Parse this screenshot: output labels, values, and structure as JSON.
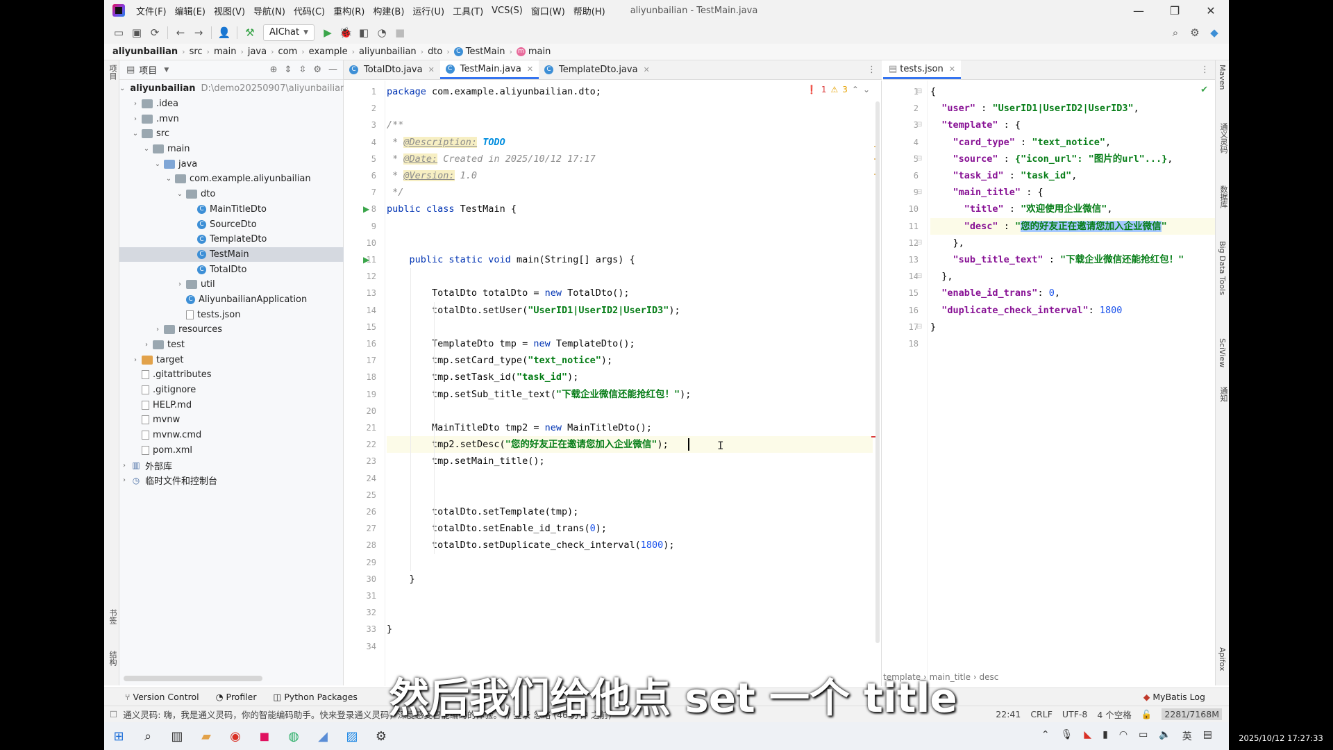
{
  "menubar": {
    "items": [
      "文件(F)",
      "编辑(E)",
      "视图(V)",
      "导航(N)",
      "代码(C)",
      "重构(R)",
      "构建(B)",
      "运行(U)",
      "工具(T)",
      "VCS(S)",
      "窗口(W)",
      "帮助(H)"
    ],
    "window_title": "aliyunbailian - TestMain.java"
  },
  "toolbar": {
    "run_config": "AIChat"
  },
  "breadcrumb": [
    "aliyunbailian",
    "src",
    "main",
    "java",
    "com",
    "example",
    "aliyunbailian",
    "dto",
    "TestMain",
    "main"
  ],
  "left_strip": {
    "project_label": "项目",
    "bookmarks_label": "书签",
    "structure_label": "结构"
  },
  "project": {
    "header": "项目",
    "root_name": "aliyunbailian",
    "root_path": "D:\\demo20250907\\aliyunbailian",
    "nodes": [
      {
        "label": ".idea"
      },
      {
        "label": ".mvn"
      },
      {
        "label": "src"
      },
      {
        "label": "main"
      },
      {
        "label": "java"
      },
      {
        "label": "com.example.aliyunbailian"
      },
      {
        "label": "dto"
      },
      {
        "label": "MainTitleDto"
      },
      {
        "label": "SourceDto"
      },
      {
        "label": "TemplateDto"
      },
      {
        "label": "TestMain"
      },
      {
        "label": "TotalDto"
      },
      {
        "label": "util"
      },
      {
        "label": "AliyunbailianApplication"
      },
      {
        "label": "tests.json"
      },
      {
        "label": "resources"
      },
      {
        "label": "test"
      },
      {
        "label": "target"
      },
      {
        "label": ".gitattributes"
      },
      {
        "label": ".gitignore"
      },
      {
        "label": "HELP.md"
      },
      {
        "label": "mvnw"
      },
      {
        "label": "mvnw.cmd"
      },
      {
        "label": "pom.xml"
      },
      {
        "label": "外部库"
      },
      {
        "label": "临时文件和控制台"
      }
    ]
  },
  "left_tabs": [
    "TotalDto.java",
    "TestMain.java",
    "TemplateDto.java"
  ],
  "right_tabs": [
    "tests.json"
  ],
  "inspections": {
    "errors": "1",
    "warnings": "3"
  },
  "left_editor": {
    "line_numbers": [
      "1",
      "2",
      "3",
      "4",
      "5",
      "6",
      "7",
      "8",
      "9",
      "10",
      "11",
      "12",
      "13",
      "14",
      "15",
      "16",
      "17",
      "18",
      "19",
      "20",
      "21",
      "22",
      "23",
      "24",
      "25",
      "26",
      "27",
      "28",
      "29",
      "30",
      "31",
      "32",
      "33",
      "34"
    ],
    "lines": [
      [
        "package com.example.aliyunbailian.dto;"
      ],
      [
        ""
      ],
      [
        "/**"
      ],
      [
        " * ",
        "@Description:",
        " ",
        "TODO"
      ],
      [
        " * ",
        "@Date:",
        " Created in 2025/10/12 17:17"
      ],
      [
        " * ",
        "@Version:",
        " 1.0"
      ],
      [
        " */"
      ],
      [
        "public class ",
        "TestMain {"
      ],
      [
        ""
      ],
      [
        ""
      ],
      [
        "    public static void ",
        "main(String[] args) {"
      ],
      [
        ""
      ],
      [
        "        TotalDto totalDto = ",
        "new ",
        "TotalDto();"
      ],
      [
        "        totalDto.setUser(",
        "\"UserID1|UserID2|UserID3\"",
        ");"
      ],
      [
        ""
      ],
      [
        "        TemplateDto tmp = ",
        "new ",
        "TemplateDto();"
      ],
      [
        "        tmp.setCard_type(",
        "\"text_notice\"",
        ");"
      ],
      [
        "        tmp.setTask_id(",
        "\"task_id\"",
        ");"
      ],
      [
        "        tmp.setSub_title_text(",
        "\"下载企业微信还能抢红包！\"",
        ");"
      ],
      [
        ""
      ],
      [
        "        MainTitleDto tmp2 = ",
        "new ",
        "MainTitleDto();"
      ],
      [
        "        tmp2.setDesc(",
        "\"您的好友正在邀请您加入企业微信\"",
        ");"
      ],
      [
        "        tmp.setMain_title();"
      ],
      [
        ""
      ],
      [
        ""
      ],
      [
        "        totalDto.setTemplate(tmp);"
      ],
      [
        "        totalDto.setEnable_id_trans(",
        "0",
        ");"
      ],
      [
        "        totalDto.setDuplicate_check_interval(",
        "1800",
        ");"
      ],
      [
        ""
      ],
      [
        "    }"
      ],
      [
        ""
      ],
      [
        ""
      ],
      [
        "}"
      ],
      [
        ""
      ]
    ]
  },
  "right_editor": {
    "line_numbers": [
      "1",
      "2",
      "3",
      "4",
      "5",
      "6",
      "9",
      "10",
      "11",
      "12",
      "13",
      "14",
      "15",
      "16",
      "17",
      "18"
    ],
    "lines": [
      [
        "{"
      ],
      [
        "  ",
        "\"user\"",
        " : ",
        "\"UserID1|UserID2|UserID3\"",
        ","
      ],
      [
        "  ",
        "\"template\"",
        " : {"
      ],
      [
        "    ",
        "\"card_type\"",
        " : ",
        "\"text_notice\"",
        ","
      ],
      [
        "    ",
        "\"source\"",
        " : ",
        "{\"icon_url\": \"图片的url\"...}",
        ","
      ],
      [
        "    ",
        "\"task_id\"",
        " : ",
        "\"task_id\"",
        ","
      ],
      [
        "    ",
        "\"main_title\"",
        " : {"
      ],
      [
        "      ",
        "\"title\"",
        " : ",
        "\"欢迎使用企业微信\"",
        ","
      ],
      [
        "      ",
        "\"desc\"",
        " : ",
        "\"",
        "您的好友正在邀请您加入企业微信",
        "\""
      ],
      [
        "    },"
      ],
      [
        "    ",
        "\"sub_title_text\"",
        " : ",
        "\"下载企业微信还能抢红包！\""
      ],
      [
        "  },"
      ],
      [
        "  ",
        "\"enable_id_trans\"",
        ": ",
        "0",
        ","
      ],
      [
        "  ",
        "\"duplicate_check_interval\"",
        ": ",
        "1800"
      ],
      [
        "}"
      ],
      [
        ""
      ]
    ],
    "bottom_breadcrumb": "template  ›  main_title  ›  desc"
  },
  "right_strip": [
    "Maven",
    "通义灵码",
    "数据库",
    "Big Data Tools",
    "SciView",
    "通知",
    "Apifox"
  ],
  "bottom_tools": {
    "version_control": "Version Control",
    "profiler": "Profiler",
    "python_packages": "Python Packages",
    "mybatis_log": "MyBatis Log"
  },
  "status": {
    "message": "通义灵码: 嗨，我是通义灵码，你的智能编码助手。快来登录通义灵码，深度感受智能编码的体验。 // 登录   忽略 (46 分钟 之前)",
    "position": "22:41",
    "line_sep": "CRLF",
    "encoding": "UTF-8",
    "indent": "4 个空格",
    "memory": "2281/7168M"
  },
  "taskbar": {
    "ime": "英",
    "clock": "2025/10/12 17:27:33"
  },
  "subtitle": "然后我们给他点 set 一个 title",
  "colors": {
    "accent": "#3574f0",
    "keyword": "#0033b3",
    "string": "#067d17",
    "number": "#1750eb",
    "selection": "#a6c8ff"
  }
}
